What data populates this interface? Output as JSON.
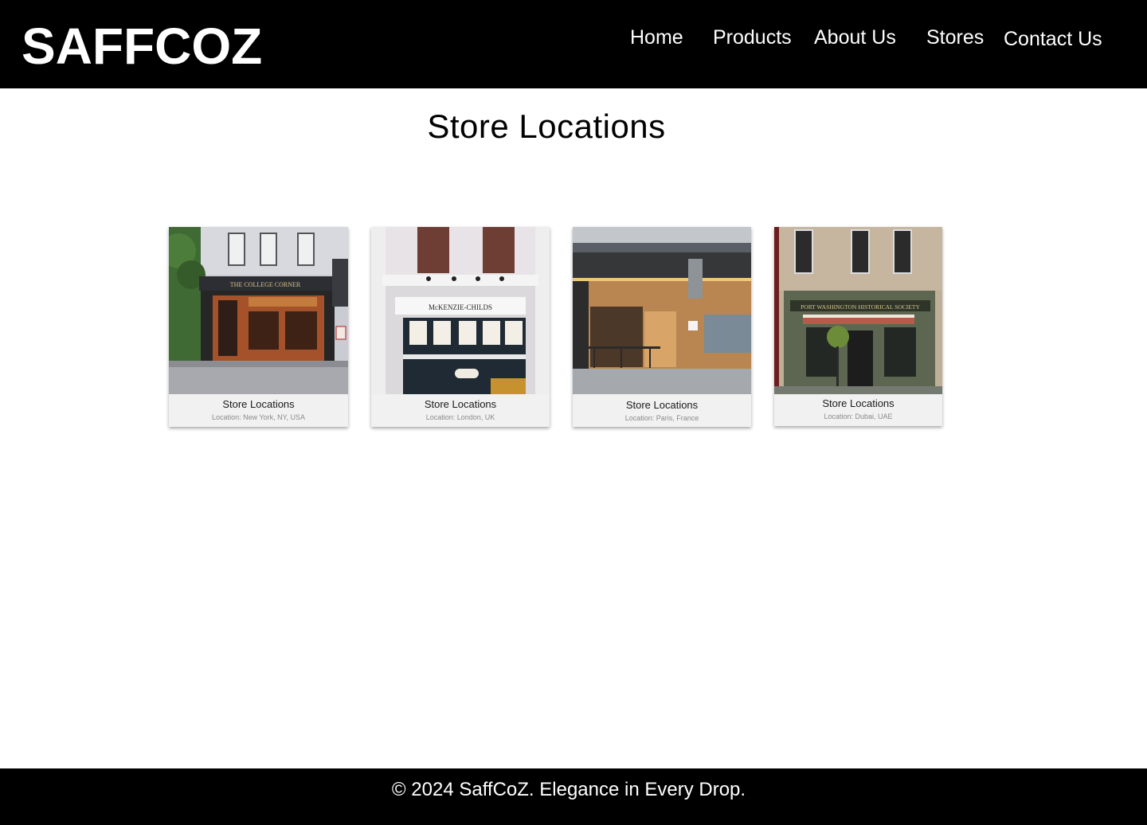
{
  "header": {
    "logo": "SAFFCOZ",
    "nav": [
      "Home",
      "Products",
      "About Us",
      "Stores",
      "Contact Us"
    ]
  },
  "main": {
    "title": "Store Locations",
    "stores": [
      {
        "title": "Store Locations",
        "location": "Location: New York, NY, USA",
        "sign": "THE COLLEGE CORNER"
      },
      {
        "title": "Store Locations",
        "location": "Location: London, UK",
        "sign": "McKENZIE-CHILDS"
      },
      {
        "title": "Store Locations",
        "location": "Location: Paris, France"
      },
      {
        "title": "Store Locations",
        "location": "Location: Dubai, UAE",
        "sign": "PORT WASHINGTON HISTORICAL SOCIETY"
      }
    ]
  },
  "footer": {
    "text": "© 2024 SaffCoZ. Elegance in Every Drop."
  }
}
